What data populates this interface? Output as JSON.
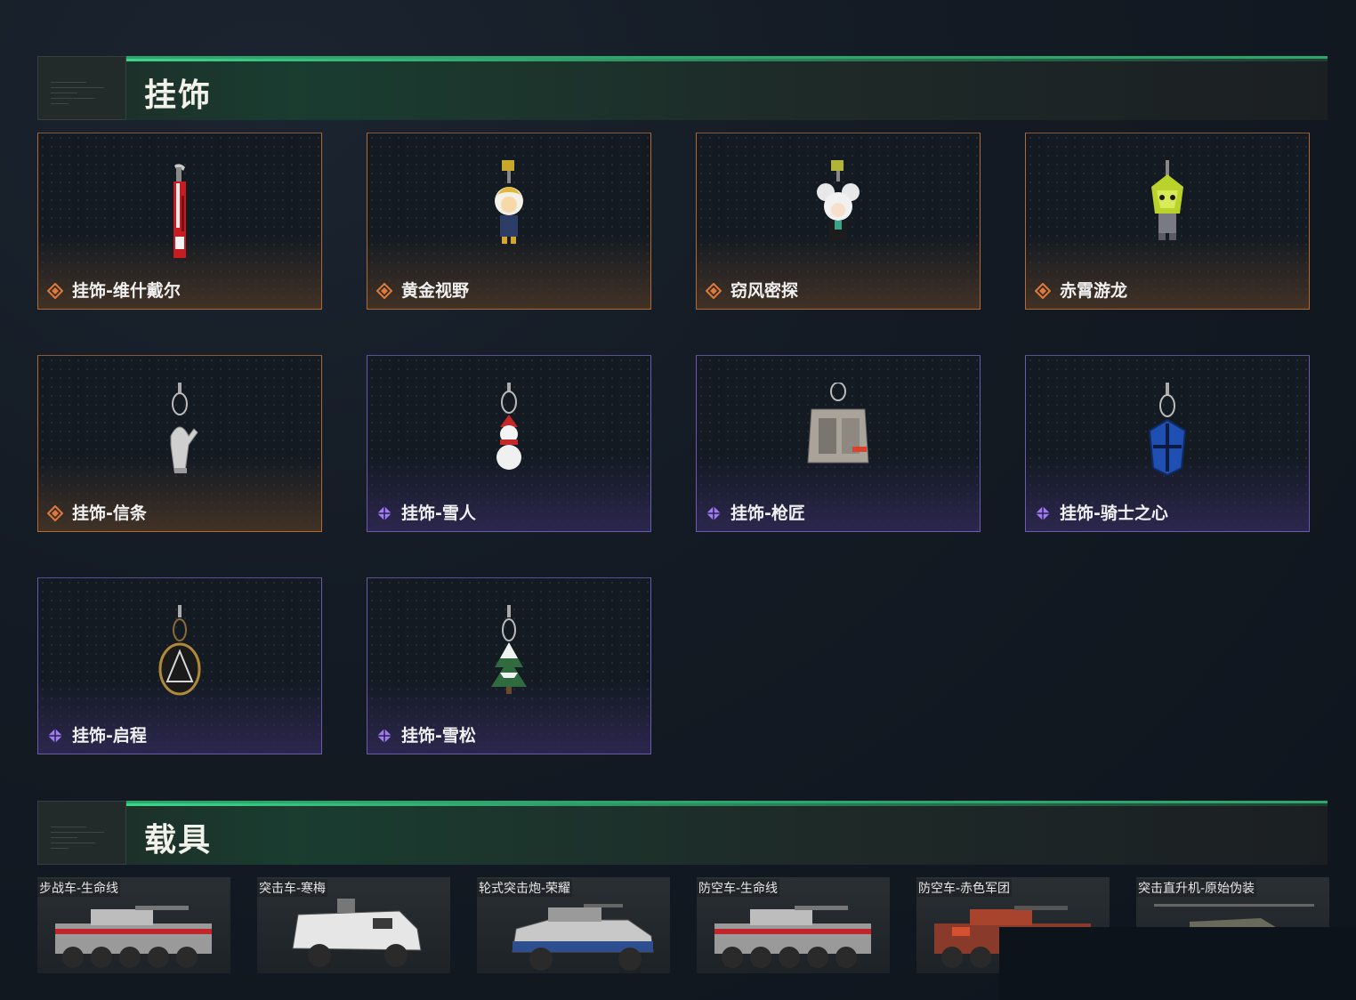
{
  "sections": {
    "charms": {
      "title": "挂饰",
      "items": [
        {
          "name": "挂饰-维什戴尔",
          "rarity": "orange",
          "icon": "charm-red-blade-icon"
        },
        {
          "name": "黄金视野",
          "rarity": "orange",
          "icon": "charm-gold-doll-icon"
        },
        {
          "name": "窃风密探",
          "rarity": "orange",
          "icon": "charm-mouse-doll-icon"
        },
        {
          "name": "赤霄游龙",
          "rarity": "orange",
          "icon": "charm-dragon-icon"
        },
        {
          "name": "挂饰-信条",
          "rarity": "orange",
          "icon": "charm-teapot-icon"
        },
        {
          "name": "挂饰-雪人",
          "rarity": "purple",
          "icon": "charm-snowman-icon"
        },
        {
          "name": "挂饰-枪匠",
          "rarity": "purple",
          "icon": "charm-case-icon"
        },
        {
          "name": "挂饰-骑士之心",
          "rarity": "purple",
          "icon": "charm-blue-shield-icon"
        },
        {
          "name": "挂饰-启程",
          "rarity": "purple",
          "icon": "charm-medal-icon"
        },
        {
          "name": "挂饰-雪松",
          "rarity": "purple",
          "icon": "charm-pine-tree-icon"
        }
      ]
    },
    "vehicles": {
      "title": "载具",
      "items": [
        {
          "name": "步战车-生命线",
          "icon": "ifv-icon"
        },
        {
          "name": "突击车-寒梅",
          "icon": "assault-car-icon"
        },
        {
          "name": "轮式突击炮-荣耀",
          "icon": "wheeled-gun-icon"
        },
        {
          "name": "防空车-生命线",
          "icon": "aa-vehicle-icon"
        },
        {
          "name": "防空车-赤色军团",
          "icon": "aa-vehicle-red-icon"
        },
        {
          "name": "突击直升机-原始伪装",
          "icon": "helicopter-icon"
        }
      ]
    }
  },
  "colors": {
    "accent_green": "#2fa56b",
    "rarity_orange": "#b26a32",
    "rarity_purple": "#6a5ab0",
    "rarity_icon_orange": "#e07a3a",
    "rarity_icon_purple": "#a17cf0"
  }
}
